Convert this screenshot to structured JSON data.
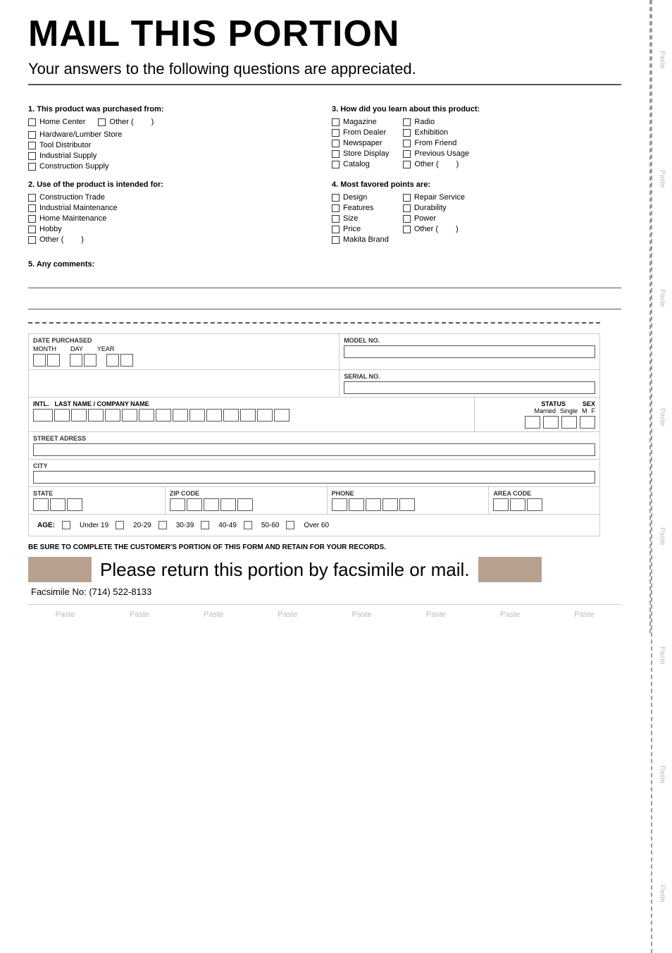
{
  "header": {
    "title": "MAIL THIS PORTION",
    "subtitle": "Your answers to the following questions are appreciated."
  },
  "questions": {
    "q1": {
      "label": "1. This product was purchased from:",
      "options": [
        {
          "text": "Home Center"
        },
        {
          "text": "Other (",
          "has_paren": true
        },
        {
          "text": "Hardware/Lumber Store"
        },
        {
          "text": "Tool Distributor"
        },
        {
          "text": "Industrial Supply"
        },
        {
          "text": "Construction Supply"
        }
      ]
    },
    "q2": {
      "label": "2. Use of the product is intended for:",
      "options": [
        {
          "text": "Construction Trade"
        },
        {
          "text": "Industrial Maintenance"
        },
        {
          "text": "Home Maintenance"
        },
        {
          "text": "Hobby"
        },
        {
          "text": "Other (",
          "has_paren": true
        }
      ]
    },
    "q3": {
      "label": "3. How did you learn about this product:",
      "options_left": [
        {
          "text": "Magazine"
        },
        {
          "text": "From Dealer"
        },
        {
          "text": "Newspaper"
        },
        {
          "text": "Store Display"
        },
        {
          "text": "Catalog"
        }
      ],
      "options_right": [
        {
          "text": "Radio"
        },
        {
          "text": "Exhibition"
        },
        {
          "text": "From Friend"
        },
        {
          "text": "Previous Usage"
        },
        {
          "text": "Other (",
          "has_paren": true
        }
      ]
    },
    "q4": {
      "label": "4. Most favored points are:",
      "options_left": [
        {
          "text": "Design"
        },
        {
          "text": "Features"
        },
        {
          "text": "Size"
        },
        {
          "text": "Price"
        },
        {
          "text": "Makita Brand"
        }
      ],
      "options_right": [
        {
          "text": "Repair Service"
        },
        {
          "text": "Durability"
        },
        {
          "text": "Power"
        },
        {
          "text": "Other (",
          "has_paren": true
        }
      ]
    },
    "q5": {
      "label": "5. Any comments:"
    }
  },
  "form": {
    "date_purchased": "DATE PURCHASED",
    "month_label": "MONTH",
    "day_label": "DAY",
    "year_label": "YEAR",
    "model_no_label": "MODEL NO.",
    "serial_no_label": "SERIAL NO.",
    "intl_label": "INTL.",
    "last_name_label": "LAST NAME / COMPANY NAME",
    "status_label": "STATUS",
    "sex_label": "SEX",
    "married_label": "Married",
    "single_label": "Single",
    "m_label": "M",
    "f_label": "F",
    "street_label": "STREET ADRESS",
    "city_label": "CITY",
    "state_label": "STATE",
    "zip_label": "ZIP CODE",
    "phone_label": "PHONE",
    "area_code_label": "AREA CODE",
    "age_label": "AGE:",
    "age_options": [
      "Under 19",
      "20-29",
      "30-39",
      "40-49",
      "50-60",
      "Over 60"
    ]
  },
  "bottom": {
    "retain_notice": "BE SURE TO COMPLETE THE CUSTOMER'S PORTION OF THIS FORM AND RETAIN FOR YOUR RECORDS.",
    "return_text": "Please return this portion by facsimile or mail.",
    "fax_text": "Facsimile No: (714) 522-8133"
  },
  "paste_labels": [
    "Paste",
    "Paste",
    "Paste",
    "Paste",
    "Paste",
    "Paste",
    "Paste",
    "Paste"
  ],
  "side_paste_labels": [
    "Paste",
    "Paste",
    "Paste",
    "Paste",
    "Paste",
    "Paste"
  ]
}
